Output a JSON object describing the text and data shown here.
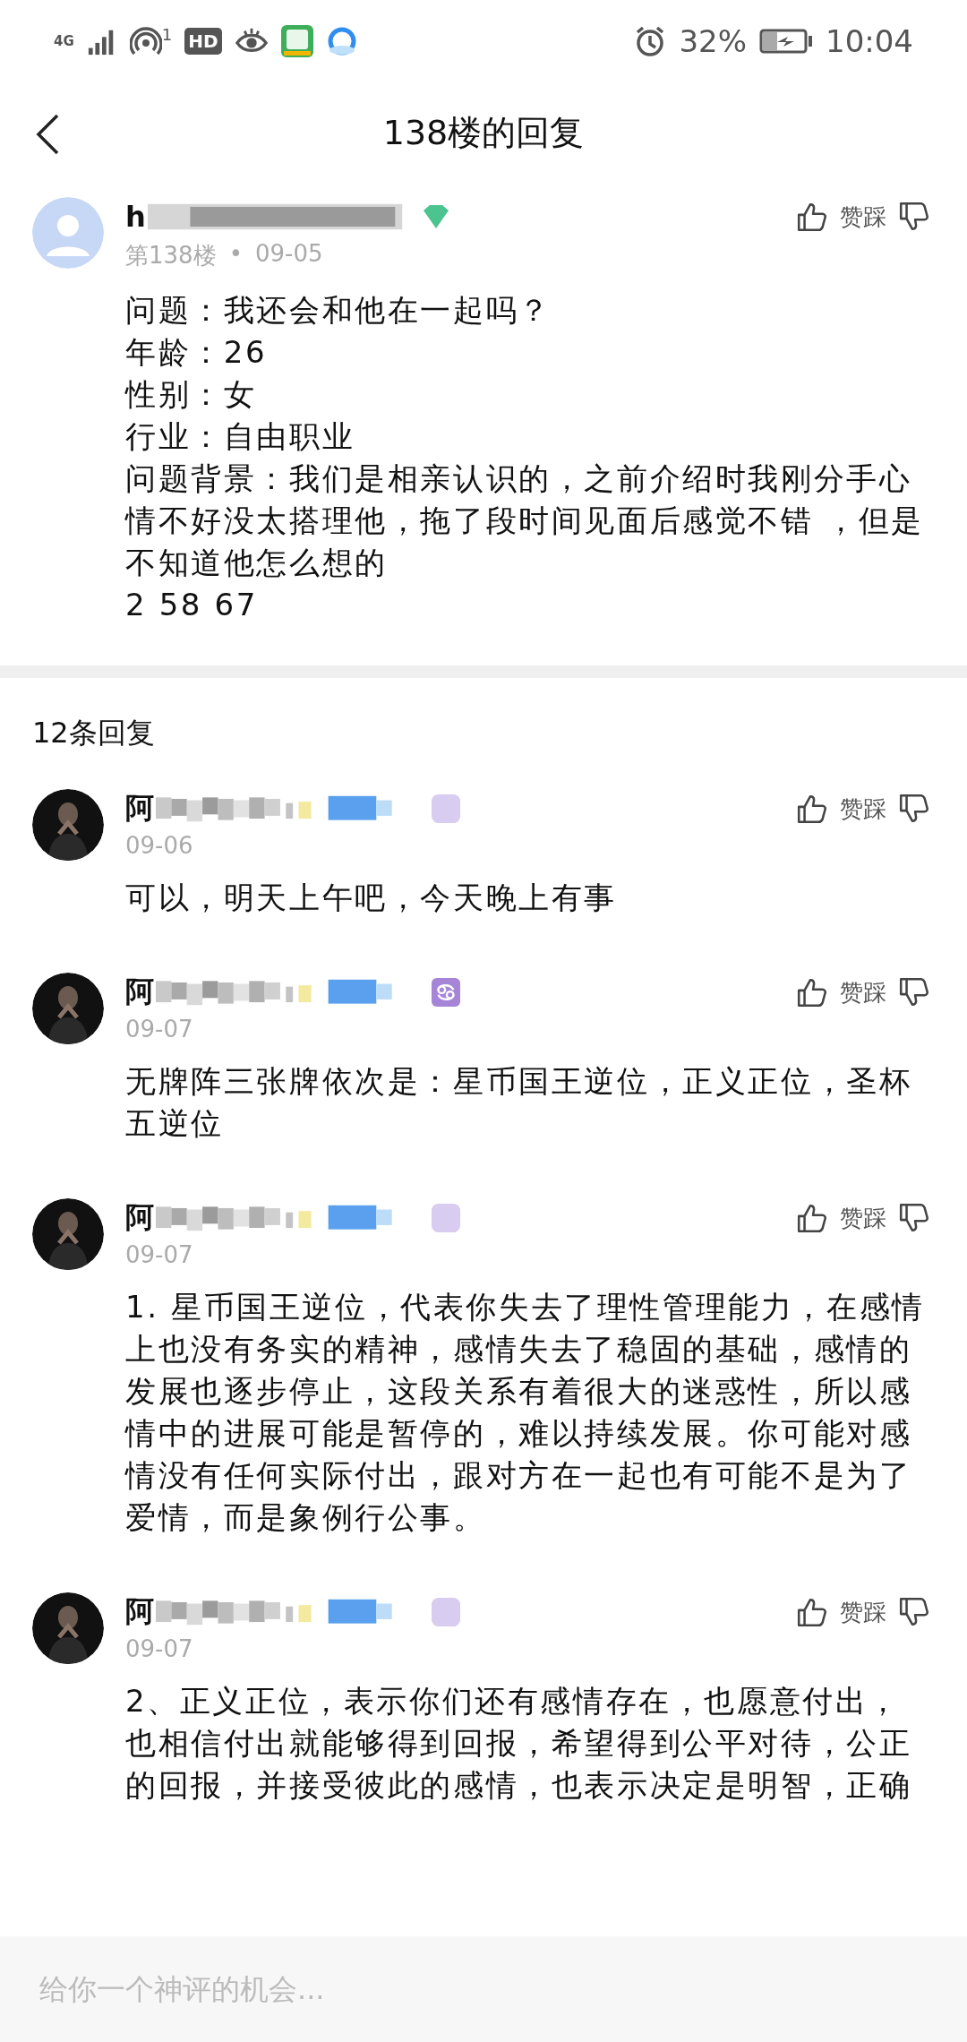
{
  "status_bar": {
    "network": "4G",
    "hotspot_count": "1",
    "hd": "HD",
    "battery": "32%",
    "time": "10:04"
  },
  "header": {
    "title": "138楼的回复"
  },
  "post": {
    "author": "h",
    "floor": "第138楼",
    "separator": "•",
    "date": "09-05",
    "vote_label": "赞踩",
    "lines": [
      "问题：我还会和他在一起吗？",
      "年龄：26",
      "性别：女",
      "行业：自由职业",
      "问题背景：我们是相亲认识的，之前介绍时我刚分手心情不好没太搭理他，拖了段时间见面后感觉不错 ，但是不知道他怎么想的",
      "2 58 67"
    ]
  },
  "replies_count": "12条回复",
  "replies": [
    {
      "author": "阿",
      "date": "09-06",
      "vote_label": "赞踩",
      "zodiac_badge": false,
      "text": "可以，明天上午吧，今天晚上有事"
    },
    {
      "author": "阿",
      "date": "09-07",
      "vote_label": "赞踩",
      "zodiac_badge": true,
      "text": "无牌阵三张牌依次是：星币国王逆位，正义正位，圣杯五逆位"
    },
    {
      "author": "阿",
      "date": "09-07",
      "vote_label": "赞踩",
      "zodiac_badge": false,
      "text": "1. 星币国王逆位，代表你失去了理性管理能力，在感情上也没有务实的精神，感情失去了稳固的基础，感情的发展也逐步停止，这段关系有着很大的迷惑性，所以感情中的进展可能是暂停的，难以持续发展。你可能对感情没有任何实际付出，跟对方在一起也有可能不是为了爱情，而是象例行公事。"
    },
    {
      "author": "阿",
      "date": "09-07",
      "vote_label": "赞踩",
      "zodiac_badge": false,
      "text": "2、正义正位，表示你们还有感情存在，也愿意付出，也相信付出就能够得到回报，希望得到公平对待，公正的回报，并接受彼此的感情，也表示决定是明智，正确"
    }
  ],
  "comment_input": {
    "placeholder": "给你一个神评的机会..."
  }
}
